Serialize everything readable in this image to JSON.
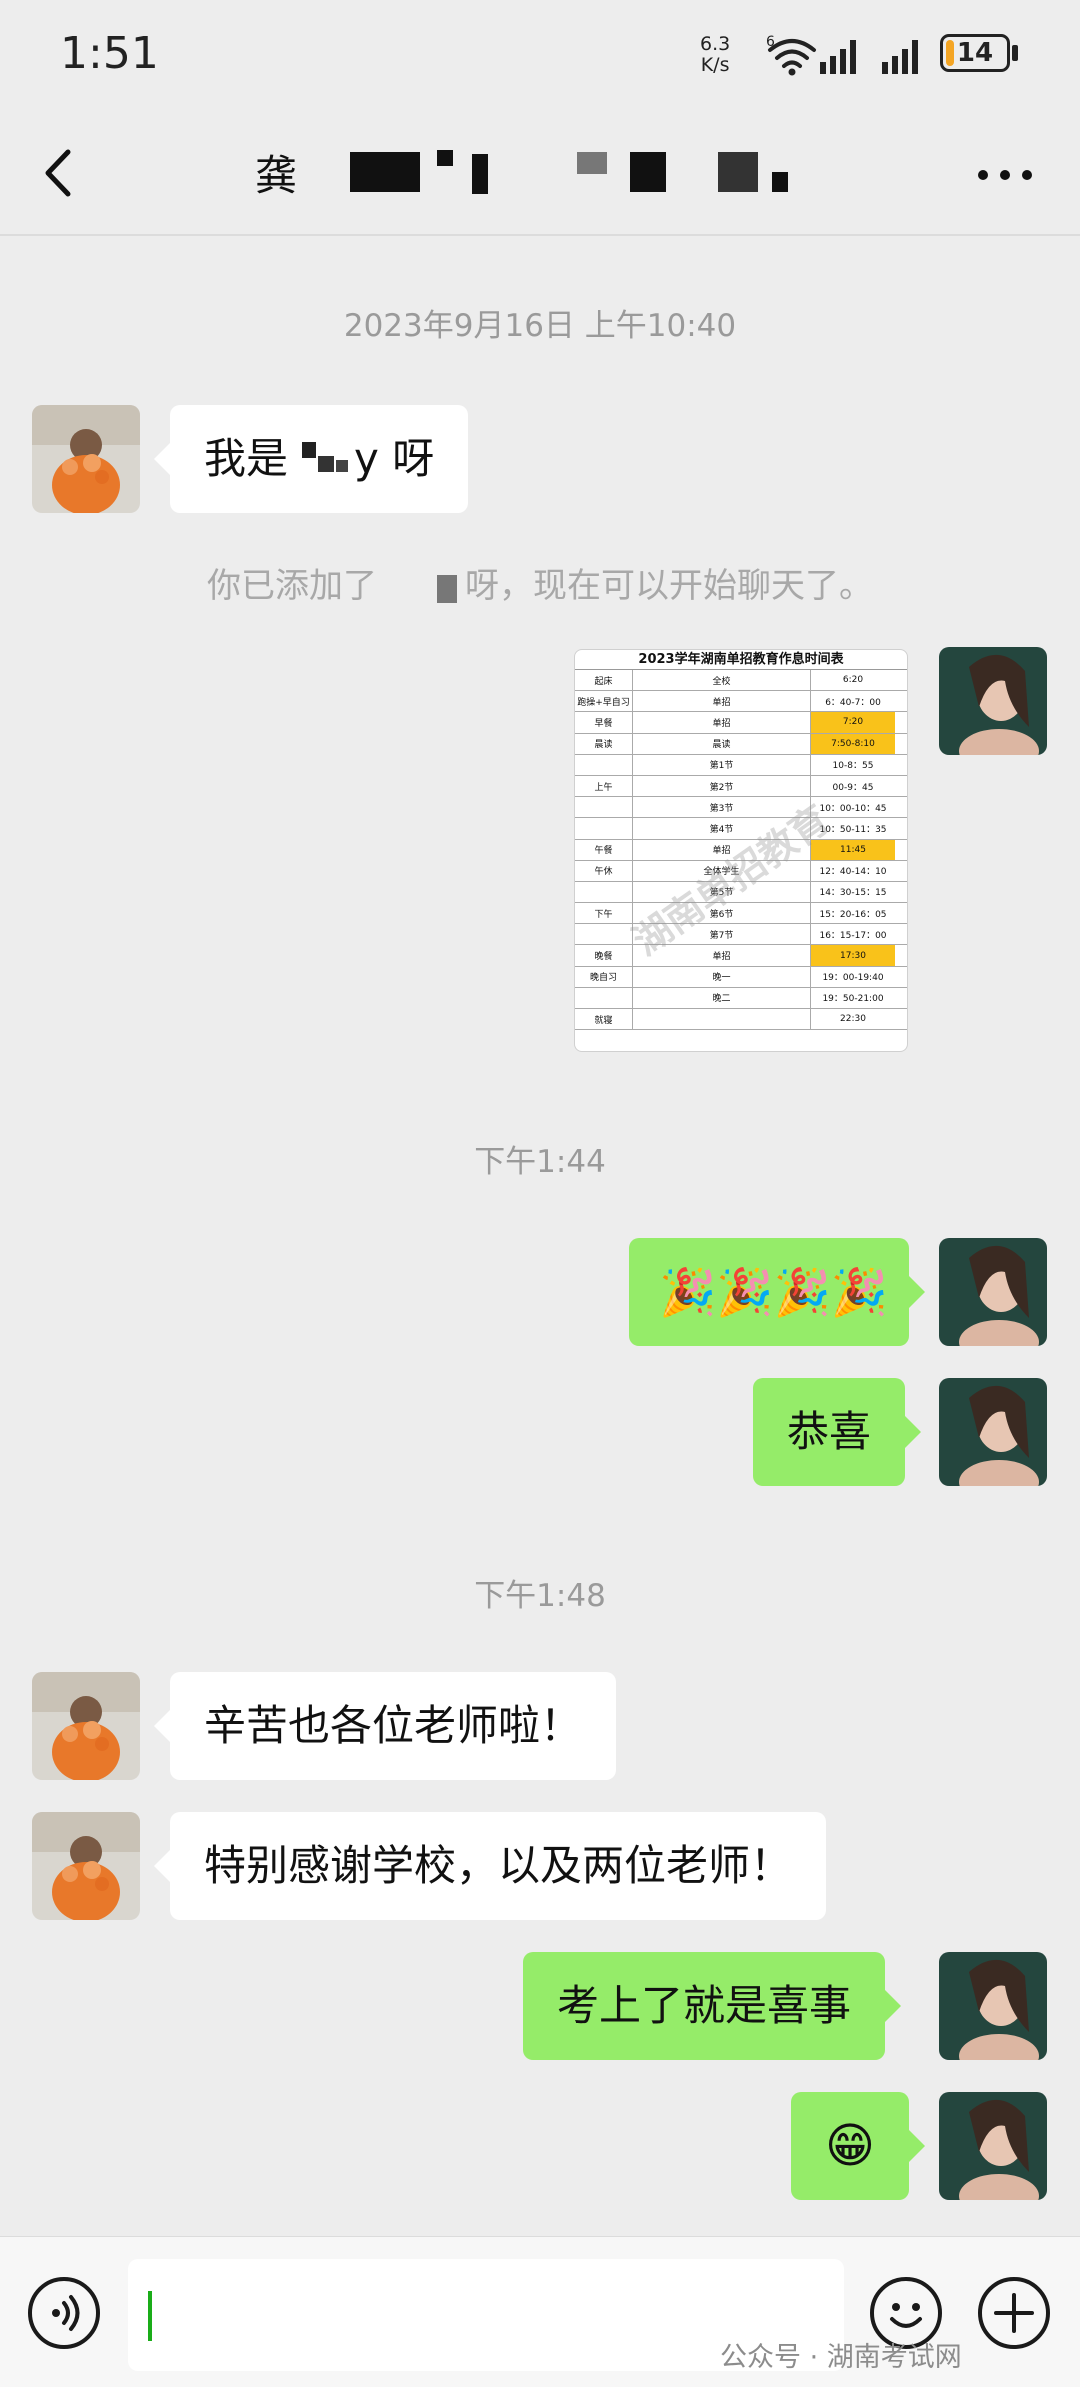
{
  "status_bar": {
    "time": "1:51",
    "net_speed_value": "6.3",
    "net_speed_unit": "K/s",
    "battery": "14",
    "battery_level": 0.14
  },
  "header": {
    "title_visible_char": "龚",
    "back_icon": "chevron-left-icon",
    "more_icon": "more-dots-icon"
  },
  "chat": {
    "timestamp_1": "2023年9月16日 上午10:40",
    "msg_1": {
      "text_a": "我是",
      "text_b": "y 呀",
      "side": "left"
    },
    "system_notice": {
      "text_a": "你已添加了",
      "text_b": "呀，现在可以开始聊天了。"
    },
    "image_msg": {
      "title": "2023学年湖南单招教育作息时间表",
      "rows": [
        [
          "起床",
          "全校",
          "6:20"
        ],
        [
          "跑操+早自习",
          "单招",
          "6：40-7：00"
        ],
        [
          "早餐",
          "单招",
          "7:20"
        ],
        [
          "晨读",
          "晨读",
          "7:50-8:10"
        ],
        [
          "",
          "第1节",
          "10-8：55"
        ],
        [
          "上午",
          "第2节",
          "00-9：45"
        ],
        [
          "",
          "第3节",
          "10：00-10：45"
        ],
        [
          "",
          "第4节",
          "10：50-11：35"
        ],
        [
          "午餐",
          "单招",
          "11:45"
        ],
        [
          "午休",
          "全体学生",
          "12：40-14：10"
        ],
        [
          "",
          "第5节",
          "14：30-15：15"
        ],
        [
          "下午",
          "第6节",
          "15：20-16：05"
        ],
        [
          "",
          "第7节",
          "16：15-17：00"
        ],
        [
          "晚餐",
          "单招",
          "17:30"
        ],
        [
          "晚自习",
          "晚一",
          "19：00-19:40"
        ],
        [
          "",
          "晚二",
          "19：50-21:00"
        ],
        [
          "就寝",
          "",
          "22:30"
        ]
      ],
      "highlight_rows": [
        2,
        3,
        8,
        13
      ]
    },
    "timestamp_2": "下午1:44",
    "msg_2": {
      "emoji": "🎉🎉🎉🎉",
      "side": "right"
    },
    "msg_3": {
      "text": "恭喜",
      "side": "right"
    },
    "timestamp_3": "下午1:48",
    "msg_4": {
      "text": "辛苦也各位老师啦！",
      "side": "left"
    },
    "msg_5": {
      "text": "特别感谢学校，以及两位老师！",
      "side": "left"
    },
    "msg_6": {
      "text": "考上了就是喜事",
      "side": "right"
    },
    "msg_7": {
      "emoji": "😁",
      "side": "right"
    }
  },
  "input_bar": {
    "voice_icon": "voice-icon",
    "emoji_icon": "emoji-icon",
    "plus_icon": "plus-icon",
    "footer_watermark": "公众号 · 湖南考试网"
  },
  "colors": {
    "background": "#ededed",
    "bubble_self": "#95ec69",
    "bubble_other": "#ffffff",
    "battery_fill": "#f4a524",
    "highlight": "#f9c21a"
  }
}
